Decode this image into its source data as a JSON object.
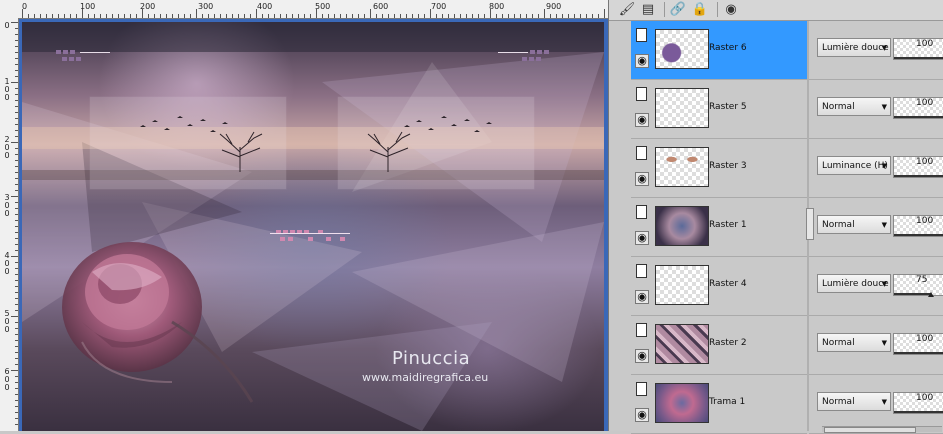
{
  "ruler": {
    "top_labels": [
      "0",
      "100",
      "200",
      "300",
      "400",
      "500",
      "600",
      "700",
      "800",
      "900"
    ],
    "left_labels": [
      "0",
      "1 0 0",
      "2 0 0",
      "3 0 0",
      "4 0 0",
      "5 0 0",
      "6 0 0"
    ]
  },
  "canvas": {
    "credit_name": "Pinuccia",
    "credit_url": "www.maidiregrafica.eu",
    "colors": {
      "frame": "#3a68b8",
      "mauve": "#8a6f84",
      "rose": "#a45a7a"
    }
  },
  "toolbar": {
    "icons": [
      "brush-icon",
      "mask-icon",
      "link-icon",
      "lock-icon",
      "globe-icon"
    ]
  },
  "layers": [
    {
      "name": "Raster 6",
      "blend": "Lumière douce",
      "opacity": "100",
      "opacity_fraction": 1.0,
      "selected": true,
      "thumb": "raster6"
    },
    {
      "name": "Raster 5",
      "blend": "Normal",
      "opacity": "100",
      "opacity_fraction": 1.0,
      "selected": false,
      "thumb": "empty"
    },
    {
      "name": "Raster 3",
      "blend": "Luminance (H)",
      "opacity": "100",
      "opacity_fraction": 1.0,
      "selected": false,
      "thumb": "raster3"
    },
    {
      "name": "Raster 1",
      "blend": "Normal",
      "opacity": "100",
      "opacity_fraction": 1.0,
      "selected": false,
      "thumb": "raster1"
    },
    {
      "name": "Raster 4",
      "blend": "Lumière douce",
      "opacity": "75",
      "opacity_fraction": 0.75,
      "selected": false,
      "thumb": "empty"
    },
    {
      "name": "Raster 2",
      "blend": "Normal",
      "opacity": "100",
      "opacity_fraction": 1.0,
      "selected": false,
      "thumb": "raster2"
    },
    {
      "name": "Trama 1",
      "blend": "Normal",
      "opacity": "100",
      "opacity_fraction": 1.0,
      "selected": false,
      "thumb": "trama1"
    }
  ]
}
